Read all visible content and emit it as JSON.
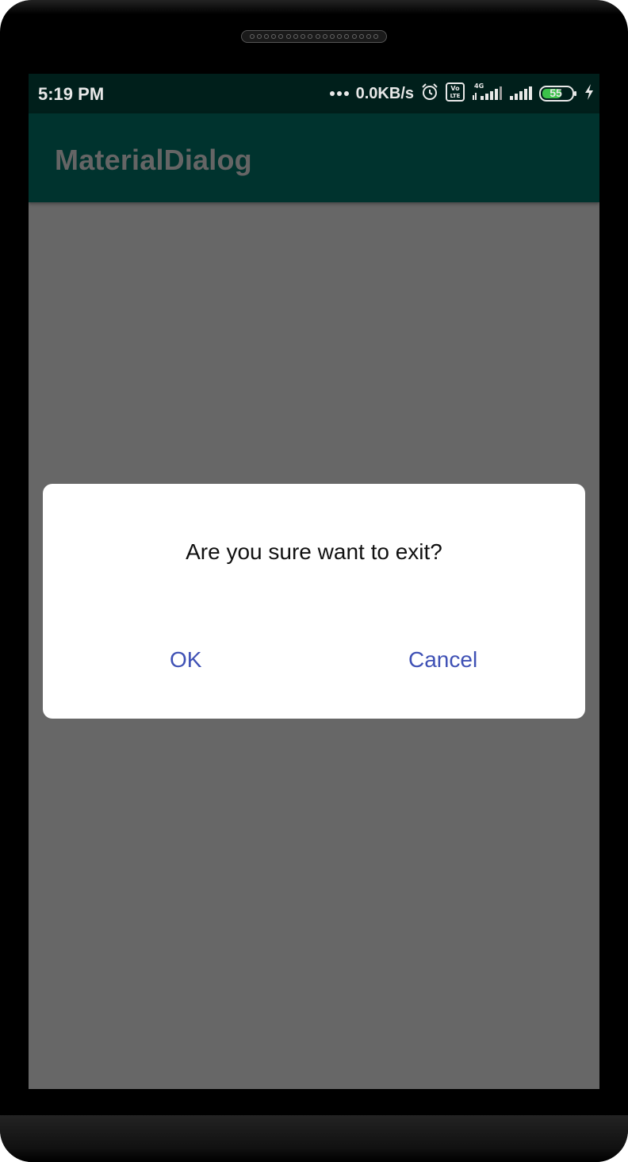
{
  "status_bar": {
    "time": "5:19 PM",
    "network_speed": "0.0KB/s",
    "network_type": "4G",
    "volte_label_top": "Vo",
    "volte_label_bottom": "LTE",
    "battery_level": "55",
    "icons": [
      "dots-icon",
      "alarm-icon",
      "volte-icon",
      "signal-4g-icon",
      "signal-icon",
      "battery-icon",
      "charging-icon"
    ]
  },
  "app_bar": {
    "title": "MaterialDialog"
  },
  "dialog": {
    "message": "Are you sure want to exit?",
    "ok_label": "OK",
    "cancel_label": "Cancel"
  },
  "colors": {
    "status_bar": "#001f1b",
    "app_bar": "#00332e",
    "scrim": "#676767",
    "dialog_button": "#3f51b5",
    "battery_fill": "#3cc24a"
  }
}
